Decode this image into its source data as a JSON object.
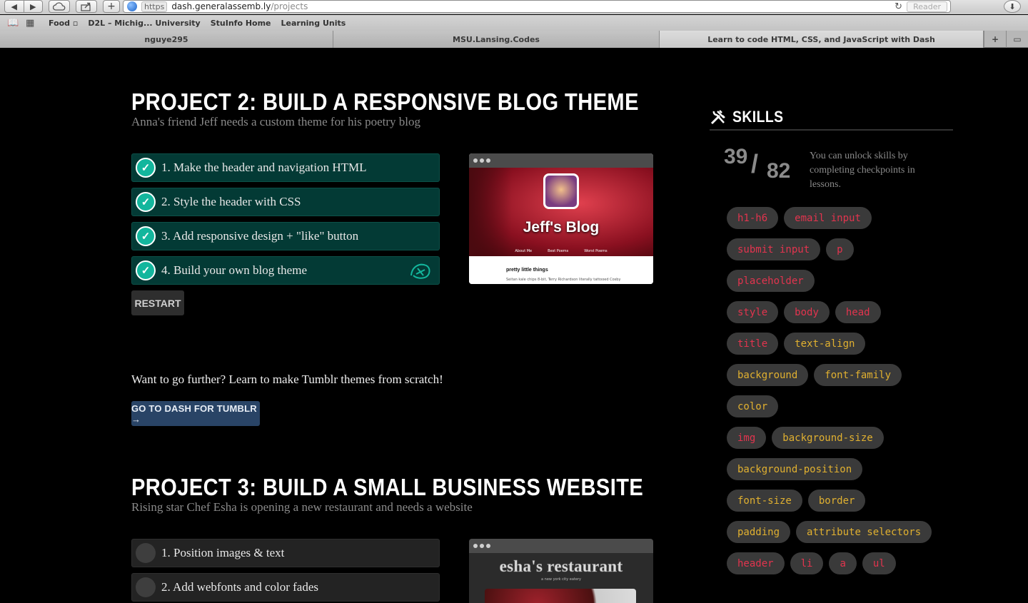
{
  "browser": {
    "url_scheme": "https",
    "url_host": "dash.generalassemb.ly",
    "url_path": "/projects",
    "reader_label": "Reader",
    "bookmarks": [
      "Food ▫",
      "D2L – Michig... University",
      "StuInfo Home",
      "Learning Units"
    ],
    "tabs": [
      "nguye295",
      "MSU.Lansing.Codes",
      "Learn to code HTML, CSS, and JavaScript with Dash"
    ]
  },
  "project2": {
    "title": "PROJECT 2: BUILD A RESPONSIVE BLOG THEME",
    "subtitle": "Anna's friend Jeff needs a custom theme for his poetry blog",
    "steps": [
      {
        "label": "1. Make the header and navigation HTML",
        "done": true
      },
      {
        "label": "2. Style the header with CSS",
        "done": true
      },
      {
        "label": "3. Add responsive design + \"like\" button",
        "done": true
      },
      {
        "label": "4. Build your own blog theme",
        "done": true
      }
    ],
    "restart_label": "RESTART",
    "thumb": {
      "blog_title": "Jeff's Blog",
      "nav": [
        "About Me",
        "Best Poems",
        "Worst Poems"
      ],
      "post_title": "pretty little things",
      "post_text": "Seitan kale chips 8-bit, Terry Richardson literally tattooed Cosby"
    },
    "further_text": "Want to go further? Learn to make Tumblr themes from scratch!",
    "tumblr_label": "GO TO DASH FOR TUMBLR →"
  },
  "project3": {
    "title": "PROJECT 3: BUILD A SMALL BUSINESS WEBSITE",
    "subtitle": "Rising star Chef Esha is opening a new restaurant and needs a website",
    "steps": [
      {
        "label": "1. Position images & text",
        "done": false
      },
      {
        "label": "2. Add webfonts and color fades",
        "done": false
      }
    ],
    "thumb": {
      "restaurant_name": "esha's restaurant",
      "tagline": "a new york city eatery"
    }
  },
  "skills": {
    "title": "SKILLS",
    "unlocked": "39",
    "total": "82",
    "unlock_text": "You can unlock skills by completing checkpoints in lessons.",
    "rows": [
      [
        {
          "label": "h1-h6",
          "color": "red"
        },
        {
          "label": "email input",
          "color": "red"
        }
      ],
      [
        {
          "label": "submit input",
          "color": "red"
        },
        {
          "label": "p",
          "color": "red"
        }
      ],
      [
        {
          "label": "placeholder",
          "color": "red"
        }
      ],
      [
        {
          "label": "style",
          "color": "red"
        },
        {
          "label": "body",
          "color": "red"
        },
        {
          "label": "head",
          "color": "red"
        }
      ],
      [
        {
          "label": "title",
          "color": "red"
        },
        {
          "label": "text-align",
          "color": "yellow"
        }
      ],
      [
        {
          "label": "background",
          "color": "yellow"
        },
        {
          "label": "font-family",
          "color": "yellow"
        }
      ],
      [
        {
          "label": "color",
          "color": "yellow"
        }
      ],
      [
        {
          "label": "img",
          "color": "red"
        },
        {
          "label": "background-size",
          "color": "yellow"
        }
      ],
      [
        {
          "label": "background-position",
          "color": "yellow"
        }
      ],
      [
        {
          "label": "font-size",
          "color": "yellow"
        },
        {
          "label": "border",
          "color": "yellow"
        }
      ],
      [
        {
          "label": "padding",
          "color": "yellow"
        },
        {
          "label": "attribute selectors",
          "color": "yellow"
        }
      ],
      [
        {
          "label": "header",
          "color": "red"
        },
        {
          "label": "li",
          "color": "red"
        },
        {
          "label": "a",
          "color": "red"
        },
        {
          "label": "ul",
          "color": "red"
        }
      ]
    ],
    "colors": {
      "red": "#e2344e",
      "yellow": "#e0b030"
    }
  },
  "colors": {
    "done_step": "#033a35",
    "check": "#13b69d",
    "tumblr_btn": "#294466"
  }
}
